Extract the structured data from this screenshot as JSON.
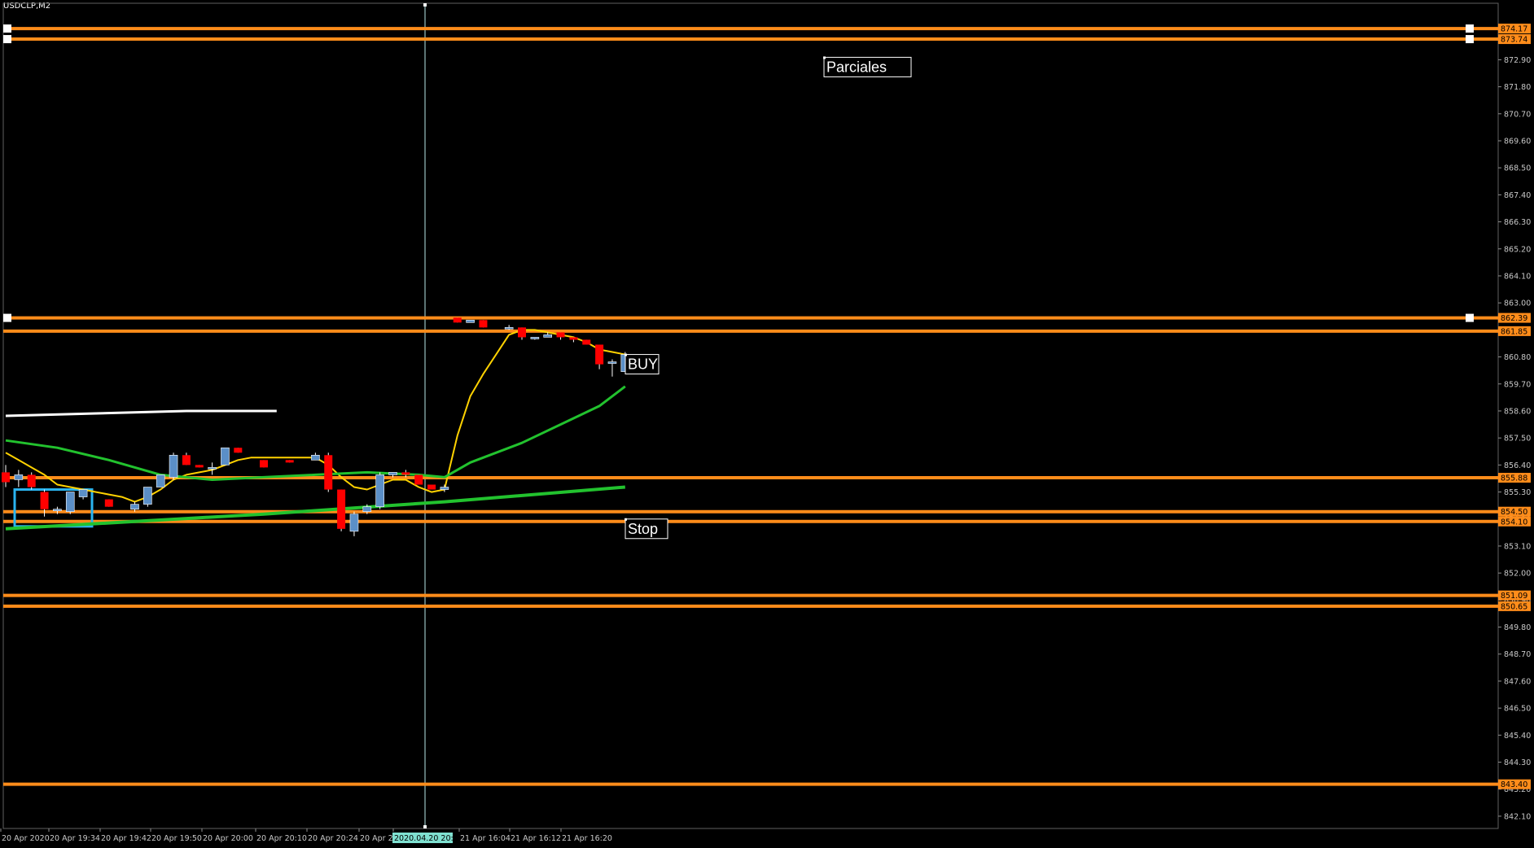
{
  "symbol_title": "USDCLP,M2",
  "colors": {
    "background": "#000000",
    "level_line": "#ff8c1a",
    "axis_text": "#c8c8c8",
    "bull": "#5b8fc7",
    "bear": "#ff0000",
    "ma_fast": "#ffd200",
    "ma_slow": "#22c22e",
    "ma_long": "#ffffff",
    "cursor_line": "#b8e8e8",
    "rect": "#2ab4f0"
  },
  "chart_data": {
    "type": "candlestick",
    "title": "USDCLP,M2",
    "ylim": [
      841.6,
      875.2
    ],
    "y_ticks": [
      "872.90",
      "871.80",
      "870.70",
      "869.60",
      "868.50",
      "867.40",
      "866.30",
      "865.20",
      "864.10",
      "863.00",
      "861.90",
      "860.80",
      "859.70",
      "858.60",
      "857.50",
      "856.40",
      "855.30",
      "854.20",
      "853.10",
      "852.00",
      "850.90",
      "849.80",
      "848.70",
      "847.60",
      "846.50",
      "845.40",
      "844.30",
      "843.20",
      "842.10"
    ],
    "x_tick_labels": [
      "20 Apr 2020",
      "20 Apr 19:34",
      "20 Apr 19:42",
      "20 Apr 19:50",
      "20 Apr 20:00",
      "20 Apr 20:10",
      "20 Apr 20:24",
      "20 Apr 20",
      "2020.04.20 20:44",
      "21 Apr 16:04",
      "21 Apr 16:12",
      "21 Apr 16:20"
    ],
    "levels": [
      {
        "value": 874.17,
        "label": "874.17"
      },
      {
        "value": 873.74,
        "label": "873.74"
      },
      {
        "value": 862.39,
        "label": "862.39"
      },
      {
        "value": 861.85,
        "label": "861.85"
      },
      {
        "value": 855.88,
        "label": "855.88"
      },
      {
        "value": 854.5,
        "label": "854.50"
      },
      {
        "value": 854.1,
        "label": "854.10"
      },
      {
        "value": 851.09,
        "label": "851.09"
      },
      {
        "value": 850.65,
        "label": "850.65"
      },
      {
        "value": 843.4,
        "label": "843.40"
      }
    ],
    "candles": [
      {
        "t": 0,
        "o": 856.1,
        "h": 856.4,
        "l": 855.5,
        "c": 855.7
      },
      {
        "t": 1,
        "o": 855.8,
        "h": 856.2,
        "l": 855.5,
        "c": 856.0
      },
      {
        "t": 2,
        "o": 856.0,
        "h": 856.1,
        "l": 855.4,
        "c": 855.5
      },
      {
        "t": 3,
        "o": 855.3,
        "h": 855.4,
        "l": 854.3,
        "c": 854.6
      },
      {
        "t": 4,
        "o": 854.6,
        "h": 854.7,
        "l": 854.4,
        "c": 854.6
      },
      {
        "t": 5,
        "o": 854.5,
        "h": 855.3,
        "l": 854.4,
        "c": 855.3
      },
      {
        "t": 6,
        "o": 855.1,
        "h": 855.4,
        "l": 855.0,
        "c": 855.4
      },
      {
        "t": 8,
        "o": 855.0,
        "h": 855.0,
        "l": 854.7,
        "c": 854.7
      },
      {
        "t": 10,
        "o": 854.6,
        "h": 854.9,
        "l": 854.5,
        "c": 854.8
      },
      {
        "t": 11,
        "o": 854.8,
        "h": 855.5,
        "l": 854.7,
        "c": 855.5
      },
      {
        "t": 12,
        "o": 855.5,
        "h": 856.0,
        "l": 855.5,
        "c": 856.0
      },
      {
        "t": 13,
        "o": 855.9,
        "h": 856.9,
        "l": 855.8,
        "c": 856.8
      },
      {
        "t": 14,
        "o": 856.8,
        "h": 856.9,
        "l": 856.4,
        "c": 856.4
      },
      {
        "t": 15,
        "o": 856.4,
        "h": 856.4,
        "l": 856.3,
        "c": 856.3
      },
      {
        "t": 16,
        "o": 856.3,
        "h": 856.5,
        "l": 856.0,
        "c": 856.3
      },
      {
        "t": 17,
        "o": 856.4,
        "h": 857.1,
        "l": 856.4,
        "c": 857.1
      },
      {
        "t": 18,
        "o": 857.1,
        "h": 857.1,
        "l": 856.9,
        "c": 856.9
      },
      {
        "t": 20,
        "o": 856.6,
        "h": 856.6,
        "l": 856.3,
        "c": 856.3
      },
      {
        "t": 22,
        "o": 856.6,
        "h": 856.6,
        "l": 856.5,
        "c": 856.5
      },
      {
        "t": 24,
        "o": 856.6,
        "h": 856.9,
        "l": 856.6,
        "c": 856.8
      },
      {
        "t": 25,
        "o": 856.8,
        "h": 856.9,
        "l": 855.3,
        "c": 855.4
      },
      {
        "t": 26,
        "o": 855.4,
        "h": 855.4,
        "l": 853.7,
        "c": 853.8
      },
      {
        "t": 27,
        "o": 853.7,
        "h": 854.5,
        "l": 853.5,
        "c": 854.4
      },
      {
        "t": 28,
        "o": 854.5,
        "h": 854.8,
        "l": 854.4,
        "c": 854.7
      },
      {
        "t": 29,
        "o": 854.7,
        "h": 856.1,
        "l": 854.6,
        "c": 856.0
      },
      {
        "t": 30,
        "o": 856.0,
        "h": 856.1,
        "l": 855.9,
        "c": 856.1
      },
      {
        "t": 31,
        "o": 856.1,
        "h": 856.2,
        "l": 855.9,
        "c": 856.0
      },
      {
        "t": 32,
        "o": 856.0,
        "h": 856.0,
        "l": 855.6,
        "c": 855.6
      },
      {
        "t": 33,
        "o": 855.6,
        "h": 855.6,
        "l": 855.4,
        "c": 855.4
      },
      {
        "t": 34,
        "o": 855.4,
        "h": 855.6,
        "l": 855.3,
        "c": 855.5
      },
      {
        "t": 35,
        "o": 862.4,
        "h": 862.4,
        "l": 862.2,
        "c": 862.2
      },
      {
        "t": 36,
        "o": 862.2,
        "h": 862.3,
        "l": 862.2,
        "c": 862.3
      },
      {
        "t": 37,
        "o": 862.3,
        "h": 862.3,
        "l": 862.0,
        "c": 862.0
      },
      {
        "t": 39,
        "o": 862.0,
        "h": 862.1,
        "l": 861.9,
        "c": 862.0
      },
      {
        "t": 40,
        "o": 862.0,
        "h": 862.0,
        "l": 861.5,
        "c": 861.6
      },
      {
        "t": 41,
        "o": 861.6,
        "h": 861.6,
        "l": 861.5,
        "c": 861.6
      },
      {
        "t": 42,
        "o": 861.6,
        "h": 861.8,
        "l": 861.6,
        "c": 861.7
      },
      {
        "t": 43,
        "o": 861.8,
        "h": 861.8,
        "l": 861.5,
        "c": 861.6
      },
      {
        "t": 44,
        "o": 861.6,
        "h": 861.6,
        "l": 861.4,
        "c": 861.5
      },
      {
        "t": 45,
        "o": 861.5,
        "h": 861.5,
        "l": 861.3,
        "c": 861.3
      },
      {
        "t": 46,
        "o": 861.3,
        "h": 861.3,
        "l": 860.3,
        "c": 860.5
      },
      {
        "t": 47,
        "o": 860.6,
        "h": 860.7,
        "l": 860.0,
        "c": 860.6
      },
      {
        "t": 48,
        "o": 860.2,
        "h": 861.0,
        "l": 860.2,
        "c": 860.9
      }
    ],
    "series": [
      {
        "type": "ma",
        "points": [
          [
            0,
            856.9
          ],
          [
            1,
            856.6
          ],
          [
            2,
            856.3
          ],
          [
            3,
            856.0
          ],
          [
            4,
            855.6
          ],
          [
            5,
            855.5
          ],
          [
            6,
            855.4
          ],
          [
            7,
            855.3
          ],
          [
            8,
            855.2
          ],
          [
            9,
            855.1
          ],
          [
            10,
            854.9
          ],
          [
            11,
            855.1
          ],
          [
            12,
            855.4
          ],
          [
            13,
            855.8
          ],
          [
            14,
            856.0
          ],
          [
            15,
            856.1
          ],
          [
            16,
            856.2
          ],
          [
            17,
            856.4
          ],
          [
            18,
            856.6
          ],
          [
            19,
            856.7
          ],
          [
            20,
            856.7
          ],
          [
            21,
            856.7
          ],
          [
            22,
            856.7
          ],
          [
            23,
            856.7
          ],
          [
            24,
            856.7
          ],
          [
            25,
            856.4
          ],
          [
            26,
            855.9
          ],
          [
            27,
            855.5
          ],
          [
            28,
            855.4
          ],
          [
            29,
            855.6
          ],
          [
            30,
            855.8
          ],
          [
            31,
            855.8
          ],
          [
            32,
            855.5
          ],
          [
            33,
            855.3
          ],
          [
            34,
            855.4
          ],
          [
            35,
            857.6
          ],
          [
            36,
            859.2
          ],
          [
            37,
            860.1
          ],
          [
            38,
            860.9
          ],
          [
            39,
            861.7
          ],
          [
            40,
            861.9
          ],
          [
            41,
            861.9
          ],
          [
            42,
            861.8
          ],
          [
            43,
            861.7
          ],
          [
            44,
            861.6
          ],
          [
            45,
            861.4
          ],
          [
            46,
            861.1
          ],
          [
            47,
            861.0
          ],
          [
            48,
            860.9
          ]
        ]
      },
      {
        "type": "ma",
        "points": [
          [
            0,
            857.4
          ],
          [
            4,
            857.1
          ],
          [
            8,
            856.6
          ],
          [
            12,
            856.0
          ],
          [
            16,
            855.8
          ],
          [
            20,
            855.9
          ],
          [
            24,
            856.0
          ],
          [
            28,
            856.1
          ],
          [
            32,
            856.0
          ],
          [
            34,
            855.9
          ],
          [
            36,
            856.5
          ],
          [
            40,
            857.3
          ],
          [
            44,
            858.3
          ],
          [
            46,
            858.8
          ],
          [
            48,
            859.6
          ]
        ]
      },
      {
        "type": "ma",
        "points": [
          [
            0,
            853.8
          ],
          [
            10,
            854.1
          ],
          [
            20,
            854.4
          ],
          [
            34,
            854.9
          ],
          [
            48,
            855.5
          ]
        ]
      },
      {
        "type": "ma",
        "points": [
          [
            0,
            858.4
          ],
          [
            7,
            858.5
          ],
          [
            14,
            858.6
          ],
          [
            21,
            858.6
          ]
        ]
      }
    ],
    "annotations": [
      {
        "text": "Parciales",
        "value": 872.9
      },
      {
        "text": "BUY",
        "value": 860.8
      },
      {
        "text": "Stop",
        "value": 854.1
      }
    ],
    "grid": false
  }
}
